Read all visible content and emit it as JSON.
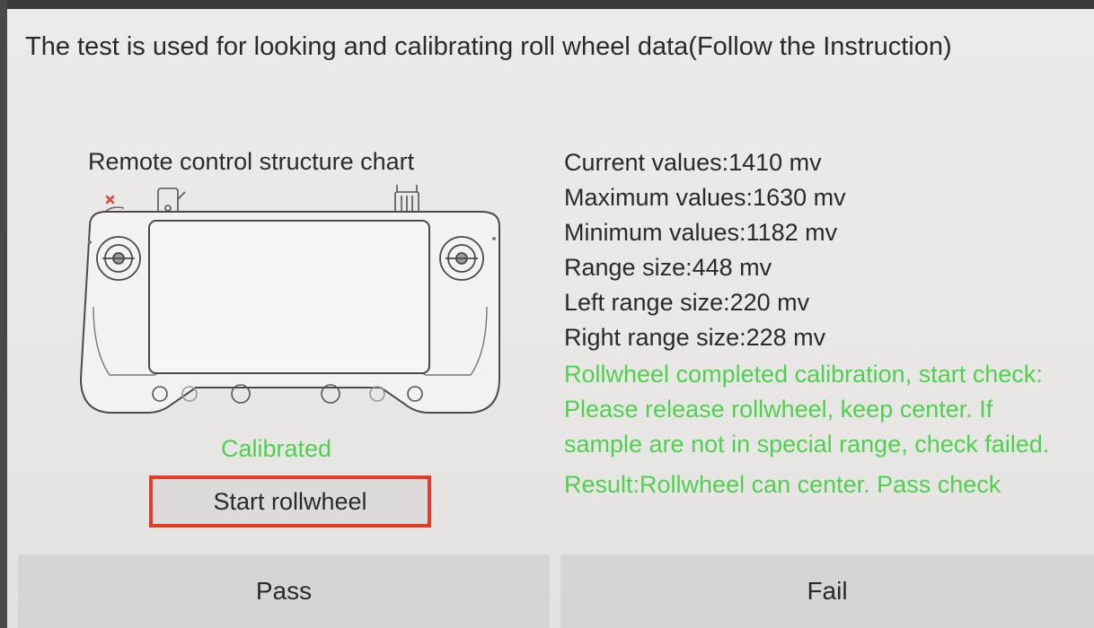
{
  "header": {
    "text": "The test is used for looking and calibrating roll wheel data(Follow the Instruction)"
  },
  "left_panel": {
    "chart_title": "Remote control structure chart",
    "status": "Calibrated",
    "start_button_label": "Start rollwheel"
  },
  "values": {
    "current": "Current values:1410 mv",
    "maximum": "Maximum values:1630 mv",
    "minimum": "Minimum values:1182 mv",
    "range": "Range size:448 mv",
    "left_range": "Left range size:220 mv",
    "right_range": "Right range size:228 mv"
  },
  "messages": {
    "calibration": "Rollwheel completed calibration, start check: Please release rollwheel, keep center. If sample are not in special range, check failed.",
    "result": "Result:Rollwheel can center. Pass check"
  },
  "buttons": {
    "pass_label": "Pass",
    "fail_label": "Fail"
  },
  "colors": {
    "status_green": "#4fd04f",
    "highlight_border": "#e23b2b",
    "button_bg": "#d6d5d3"
  }
}
